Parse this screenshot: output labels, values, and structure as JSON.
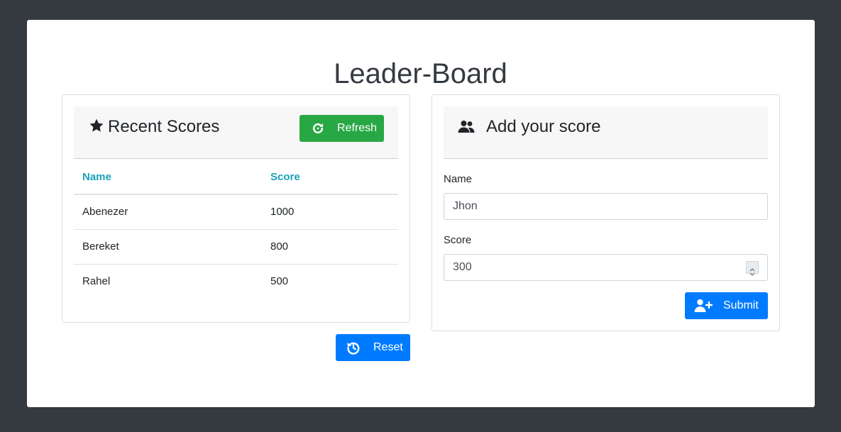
{
  "page": {
    "title": "Leader-Board"
  },
  "recent_scores": {
    "title": "Recent Scores",
    "refresh_label": "Refresh",
    "columns": [
      "Name",
      "Score"
    ],
    "rows": [
      {
        "name": "Abenezer",
        "score": "1000"
      },
      {
        "name": "Bereket",
        "score": "800"
      },
      {
        "name": "Rahel",
        "score": "500"
      }
    ],
    "reset_label": "Reset"
  },
  "add_score": {
    "title": "Add your score",
    "name_label": "Name",
    "name_value": "Jhon",
    "score_label": "Score",
    "score_value": "300",
    "submit_label": "Submit"
  },
  "icons": {
    "recent_scores": "star-icon",
    "refresh": "refresh-icon",
    "reset": "history-icon",
    "add_score": "users-icon",
    "submit": "user-plus-icon"
  },
  "colors": {
    "background": "#343a40",
    "success": "#28a745",
    "primary": "#007bff",
    "table_header": "#17a2b8"
  }
}
